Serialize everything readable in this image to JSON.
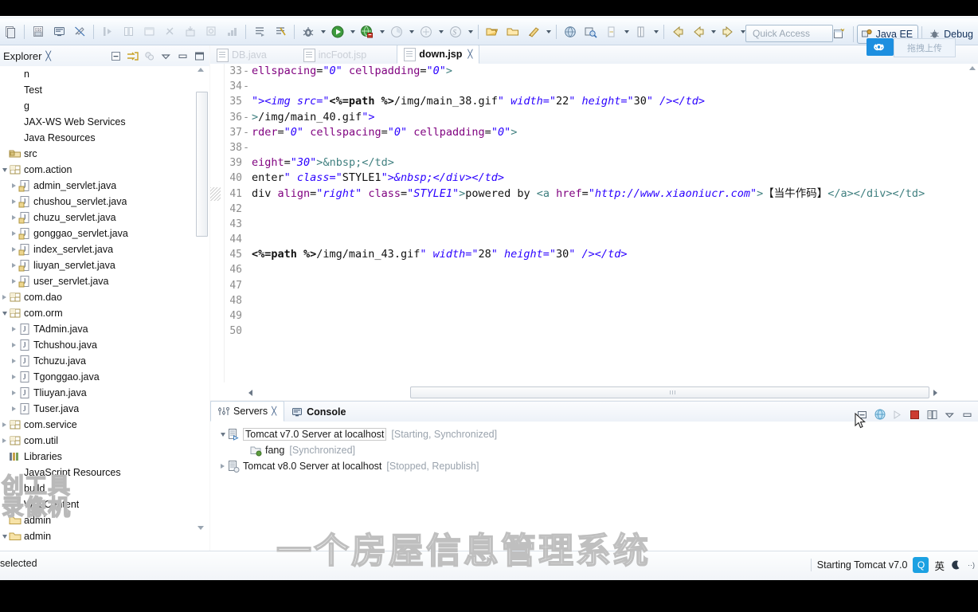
{
  "window": {
    "quick_access_placeholder": "Quick Access"
  },
  "perspectives": {
    "new_perspective_icon": "new-perspective-icon",
    "items": [
      {
        "label": "Java EE",
        "icon": "java-ee-icon",
        "active": true
      },
      {
        "label": "Debug",
        "icon": "debug-bug-icon",
        "active": false
      }
    ]
  },
  "upload_badge": {
    "icon": "infinity-upload-icon",
    "label": "拖拽上传"
  },
  "toolbar": {
    "groups": [
      {
        "items": [
          {
            "name": "new-wizard-icon",
            "arrow": false
          },
          {
            "name": "save-icon",
            "arrow": false
          }
        ]
      },
      {
        "items": [
          {
            "name": "new-jsp-file-icon",
            "arrow": false
          },
          {
            "name": "console-icon",
            "arrow": false
          },
          {
            "name": "toggle-breakpoint-icon",
            "arrow": false
          }
        ]
      },
      {
        "items": [
          {
            "name": "step-into-icon",
            "arrow": false
          },
          {
            "name": "columns-icon",
            "arrow": false
          },
          {
            "name": "window-icon",
            "arrow": false
          },
          {
            "name": "link-broken-icon",
            "arrow": false
          },
          {
            "name": "import-icon",
            "arrow": false
          },
          {
            "name": "export-icon",
            "arrow": false
          },
          {
            "name": "stack-icon",
            "arrow": false
          }
        ]
      },
      {
        "items": [
          {
            "name": "run-last-tool-icon",
            "arrow": false
          },
          {
            "name": "validate-icon",
            "arrow": false
          }
        ]
      },
      {
        "items": [
          {
            "name": "debug-icon",
            "arrow": true
          },
          {
            "name": "run-icon",
            "arrow": true
          },
          {
            "name": "run-on-server-icon",
            "arrow": true
          },
          {
            "name": "profile-icon",
            "arrow": true
          },
          {
            "name": "coverage-icon",
            "arrow": true
          },
          {
            "name": "subversion-icon",
            "arrow": true
          }
        ]
      },
      {
        "items": [
          {
            "name": "open-type-icon",
            "arrow": false
          },
          {
            "name": "open-task-icon",
            "arrow": false
          },
          {
            "name": "new-java-class-icon",
            "arrow": true
          }
        ]
      },
      {
        "items": [
          {
            "name": "open-web-browser-icon",
            "arrow": false
          },
          {
            "name": "search-icon",
            "arrow": false
          },
          {
            "name": "next-annotation-icon",
            "arrow": true
          },
          {
            "name": "previous-annotation-icon",
            "arrow": true
          }
        ]
      },
      {
        "items": [
          {
            "name": "back-icon",
            "arrow": false
          },
          {
            "name": "backward-history-icon",
            "arrow": true
          },
          {
            "name": "forward-history-icon",
            "arrow": true
          }
        ]
      }
    ]
  },
  "explorer": {
    "title": "Explorer",
    "close_icon": "close-view-icon",
    "tools": [
      {
        "name": "collapse-all-icon"
      },
      {
        "name": "link-with-editor-icon"
      },
      {
        "name": "filter-icon"
      },
      {
        "name": "view-menu-icon"
      },
      {
        "name": "minimize-view-icon"
      },
      {
        "name": "maximize-view-icon"
      }
    ],
    "tree": [
      {
        "label": "n",
        "indent": 0,
        "twisty": "none",
        "icon": "none"
      },
      {
        "label": "Test",
        "indent": 0,
        "twisty": "none",
        "icon": "none"
      },
      {
        "label": "g",
        "indent": 0,
        "twisty": "none",
        "icon": "none"
      },
      {
        "label": "JAX-WS Web Services",
        "indent": 0,
        "twisty": "none",
        "icon": "none"
      },
      {
        "label": "Java Resources",
        "indent": 0,
        "twisty": "none",
        "icon": "none"
      },
      {
        "label": "src",
        "indent": 0,
        "twisty": "none",
        "icon": "source-folder-icon"
      },
      {
        "label": "com.action",
        "indent": 1,
        "twisty": "open",
        "icon": "package-icon"
      },
      {
        "label": "admin_servlet.java",
        "indent": 2,
        "twisty": "closed",
        "icon": "java-servlet-file-icon"
      },
      {
        "label": "chushou_servlet.java",
        "indent": 2,
        "twisty": "closed",
        "icon": "java-servlet-file-icon"
      },
      {
        "label": "chuzu_servlet.java",
        "indent": 2,
        "twisty": "closed",
        "icon": "java-servlet-file-icon"
      },
      {
        "label": "gonggao_servlet.java",
        "indent": 2,
        "twisty": "closed",
        "icon": "java-servlet-file-icon"
      },
      {
        "label": "index_servlet.java",
        "indent": 2,
        "twisty": "closed",
        "icon": "java-servlet-file-icon"
      },
      {
        "label": "liuyan_servlet.java",
        "indent": 2,
        "twisty": "closed",
        "icon": "java-servlet-file-icon"
      },
      {
        "label": "user_servlet.java",
        "indent": 2,
        "twisty": "closed",
        "icon": "java-servlet-file-icon"
      },
      {
        "label": "com.dao",
        "indent": 1,
        "twisty": "closed",
        "icon": "package-icon"
      },
      {
        "label": "com.orm",
        "indent": 1,
        "twisty": "open",
        "icon": "package-icon"
      },
      {
        "label": "TAdmin.java",
        "indent": 2,
        "twisty": "closed",
        "icon": "java-file-icon"
      },
      {
        "label": "Tchushou.java",
        "indent": 2,
        "twisty": "closed",
        "icon": "java-file-icon"
      },
      {
        "label": "Tchuzu.java",
        "indent": 2,
        "twisty": "closed",
        "icon": "java-file-icon"
      },
      {
        "label": "Tgonggao.java",
        "indent": 2,
        "twisty": "closed",
        "icon": "java-file-icon"
      },
      {
        "label": "Tliuyan.java",
        "indent": 2,
        "twisty": "closed",
        "icon": "java-file-icon"
      },
      {
        "label": "Tuser.java",
        "indent": 2,
        "twisty": "closed",
        "icon": "java-file-icon"
      },
      {
        "label": "com.service",
        "indent": 1,
        "twisty": "closed",
        "icon": "package-icon"
      },
      {
        "label": "com.util",
        "indent": 1,
        "twisty": "closed",
        "icon": "package-icon"
      },
      {
        "label": "Libraries",
        "indent": 0,
        "twisty": "none",
        "icon": "libraries-icon"
      },
      {
        "label": "JavaScript Resources",
        "indent": 0,
        "twisty": "none",
        "icon": "none"
      },
      {
        "label": "build",
        "indent": 0,
        "twisty": "none",
        "icon": "none"
      },
      {
        "label": "WebContent",
        "indent": 0,
        "twisty": "none",
        "icon": "none"
      },
      {
        "label": "admin",
        "indent": 0,
        "twisty": "none",
        "icon": "folder-icon"
      },
      {
        "label": "admin",
        "indent": 0,
        "twisty": "open",
        "icon": "folder-icon"
      }
    ]
  },
  "editor": {
    "tabs": [
      {
        "label": "DB.java",
        "icon": "java-file-icon",
        "active": false,
        "close": false
      },
      {
        "label": "incFoot.jsp",
        "icon": "jsp-file-icon",
        "active": false,
        "close": false
      },
      {
        "label": "down.jsp",
        "icon": "jsp-file-icon",
        "active": true,
        "close": true
      }
    ],
    "close_glyph": "✂",
    "lines": [
      {
        "no": "33",
        "fold": "-",
        "text": "ellspacing=\"0\" cellpadding=\"0\">"
      },
      {
        "no": "34",
        "fold": "-",
        "text": ""
      },
      {
        "no": "35",
        "fold": "",
        "text": "\"><img src=\"<%=path %>/img/main_38.gif\" width=\"22\" height=\"30\" /></td>"
      },
      {
        "no": "36",
        "fold": "-",
        "text": ">/img/main_40.gif\">"
      },
      {
        "no": "37",
        "fold": "-",
        "text": "rder=\"0\" cellspacing=\"0\" cellpadding=\"0\">"
      },
      {
        "no": "38",
        "fold": "-",
        "text": ""
      },
      {
        "no": "39",
        "fold": "",
        "text": "eight=\"30\">&nbsp;</td>"
      },
      {
        "no": "40",
        "fold": "",
        "text": "enter\" class=\"STYLE1\">&nbsp;</div></td>"
      },
      {
        "no": "41",
        "fold": "",
        "text": "div align=\"right\" class=\"STYLE1\">powered by <a href=\"http://www.xiaoniucr.com\">【当牛作码】</a></div></td>"
      },
      {
        "no": "42",
        "fold": "",
        "text": ""
      },
      {
        "no": "43",
        "fold": "",
        "text": ""
      },
      {
        "no": "44",
        "fold": "",
        "text": ""
      },
      {
        "no": "45",
        "fold": "",
        "text": "<%=path %>/img/main_43.gif\" width=\"28\" height=\"30\" /></td>"
      },
      {
        "no": "46",
        "fold": "",
        "text": ""
      },
      {
        "no": "47",
        "fold": "",
        "text": ""
      },
      {
        "no": "48",
        "fold": "",
        "text": ""
      },
      {
        "no": "49",
        "fold": "",
        "text": ""
      },
      {
        "no": "50",
        "fold": "",
        "text": ""
      }
    ]
  },
  "bottom_panel": {
    "tabs": [
      {
        "label": "Servers",
        "icon": "servers-icon",
        "active": true,
        "close": true
      },
      {
        "label": "Console",
        "icon": "console-icon",
        "active": false,
        "close": false
      }
    ],
    "tools": [
      {
        "name": "minimize-panel-icon"
      },
      {
        "name": "start-server-icon"
      },
      {
        "name": "debug-server-icon"
      },
      {
        "name": "stop-server-icon"
      },
      {
        "name": "publish-icon"
      },
      {
        "name": "view-menu-icon"
      },
      {
        "name": "maximize-panel-icon"
      }
    ],
    "servers": [
      {
        "name": "Tomcat v7.0 Server at localhost",
        "status": "[Starting, Synchronized]",
        "twisty": "open",
        "selected": true,
        "icon": "server-running-icon",
        "indent": 0
      },
      {
        "name": "fang",
        "status": "[Synchronized]",
        "twisty": "none",
        "selected": false,
        "icon": "module-icon",
        "indent": 1
      },
      {
        "name": "Tomcat v8.0 Server at localhost",
        "status": "[Stopped, Republish]",
        "twisty": "closed",
        "selected": false,
        "icon": "server-stopped-icon",
        "indent": 0
      }
    ]
  },
  "status_bar": {
    "left_text": "selected",
    "right_text": "Starting Tomcat v7.0",
    "ime_letter": "Q",
    "ime_lang": "英",
    "ime_moon_icon": "moon-icon",
    "ime_more_icon": "more-icon"
  },
  "watermarks": {
    "big": "一个房屋信息管理系统",
    "small_line1": "创工具",
    "small_line2": "录像机"
  },
  "colors": {
    "accent": "#1d8fe0",
    "string_literal": "#2a00ff",
    "tag": "#3f7f7f",
    "attribute": "#7f007f",
    "line_number": "#8d8d8d",
    "muted_text": "#9aa3ad",
    "stop_red": "#cc3b30",
    "run_green": "#3f9a3f"
  }
}
